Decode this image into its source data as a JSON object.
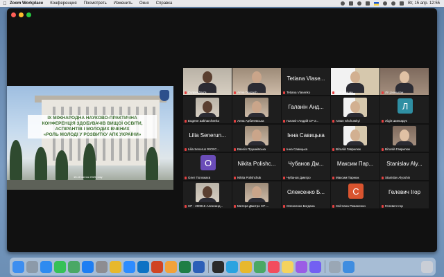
{
  "menubar": {
    "app_name": "Zoom Workplace",
    "items": [
      "Конференция",
      "Посмотреть",
      "Изменить",
      "Окно",
      "Справка"
    ],
    "clock": "Вт, 15 апр. 12:55"
  },
  "slide": {
    "lines": [
      "IX МІЖНАРОДНА НАУКОВО-ПРАКТИЧНА",
      "КОНФЕРЕНЦІЯ ЗДОБУВАЧІВ ВИЩОЇ ОСВІТИ,",
      "АСПІРАНТІВ І МОЛОДИХ ВЧЕНИХ",
      "«РОЛЬ МОЛОДІ У РОЗВИТКУ АПК УКРАЇНИ»"
    ],
    "date": "15-16 квітня 2025 року"
  },
  "participants": [
    {
      "big": "",
      "label": "СупрунДар'я",
      "type": "video",
      "active": true
    },
    {
      "big": "",
      "label": "Anna Dergach",
      "type": "video"
    },
    {
      "big": "Tetiana Vlase...",
      "label": "Tetiana Vlasenko",
      "type": "name"
    },
    {
      "big": "",
      "label": "Бай Дунцин",
      "type": "video"
    },
    {
      "big": "",
      "label": "Лі Цзюньлан",
      "type": "video"
    },
    {
      "big": "",
      "label": "Eugene Zakharchenko",
      "type": "video"
    },
    {
      "big": "",
      "label": "Анна Арбачевська",
      "type": "video"
    },
    {
      "big": "Галанін Анд...",
      "label": "Галанін Андрій СР-2...",
      "type": "name"
    },
    {
      "big": "",
      "label": "Anton Shchutskyi",
      "type": "video"
    },
    {
      "big": "Л",
      "label": "Лідія Шинкарук",
      "type": "avatar",
      "color": "#2f8fa3"
    },
    {
      "big": "Lilia Senerun...",
      "label": "Lilia Senerun RICEC...",
      "type": "name"
    },
    {
      "big": "",
      "label": "Евеліп Прушківська",
      "type": "video"
    },
    {
      "big": "Інна Савицька",
      "label": "Інна Савицька",
      "type": "name"
    },
    {
      "big": "",
      "label": "Віталій Гаврилюк",
      "type": "video"
    },
    {
      "big": "",
      "label": "Віталій Гаврилюк",
      "type": "video"
    },
    {
      "big": "О",
      "label": "Олег Полєжаєв",
      "type": "avatar",
      "color": "#6a4cb8"
    },
    {
      "big": "Nikita Polishc...",
      "label": "Nikita Polishchuk",
      "type": "name"
    },
    {
      "big": "Чубанов Дм...",
      "label": "Чубанов Дмитро",
      "type": "name"
    },
    {
      "big": "Максим Пар...",
      "label": "Максим Парнюк",
      "type": "name"
    },
    {
      "big": "Stanislav Aly...",
      "label": "Stanislav Alyoshin",
      "type": "name"
    },
    {
      "big": "",
      "label": "СР - 200016 Александ...",
      "type": "video"
    },
    {
      "big": "",
      "label": "Матера Дмитро СР-...",
      "type": "video"
    },
    {
      "big": "Олексенко Б...",
      "label": "Олексенко Богдана",
      "type": "name"
    },
    {
      "big": "С",
      "label": "Світлана Романенко",
      "type": "avatar",
      "color": "#d9542f"
    },
    {
      "big": "Гелевич Ігор",
      "label": "Гелевич Ігор",
      "type": "name"
    }
  ],
  "dock_apps": [
    "finder-icon",
    "launchpad-icon",
    "safari-icon",
    "facetime-icon",
    "maps-icon",
    "appstore-icon",
    "settings-icon",
    "chrome-icon",
    "zoom-icon",
    "outlook-icon",
    "powerpoint-icon",
    "photos-icon",
    "excel-icon",
    "word-icon",
    "terminal-icon",
    "telegram-icon",
    "chrome2-icon",
    "maps2-icon",
    "music-icon",
    "notes-icon",
    "podcasts-icon",
    "viber-icon",
    "preview-icon",
    "mail-icon"
  ],
  "colors": {
    "active_speaker": "#3fd43a",
    "mic_muted": "#e64040",
    "window_bg": "#111111"
  }
}
